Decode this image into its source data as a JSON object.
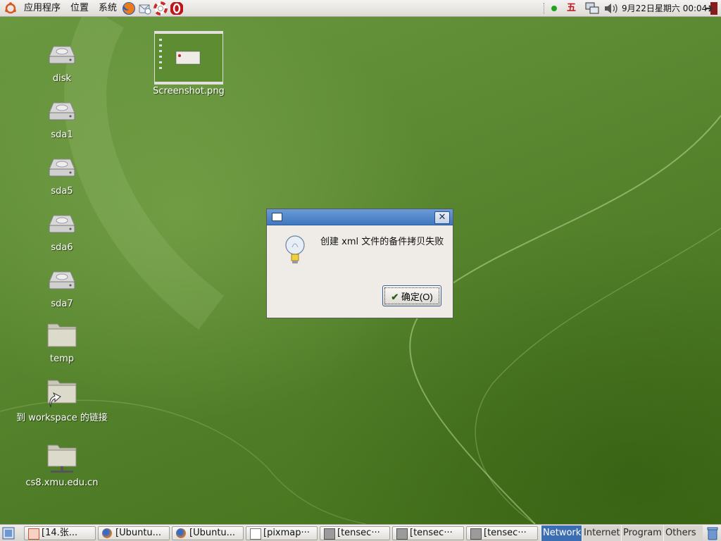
{
  "top_panel": {
    "menus": [
      "应用程序",
      "位置",
      "系统"
    ],
    "indicator_char": "五",
    "clock": "9月22日星期六 00:04"
  },
  "desktop": {
    "icons": [
      {
        "label": "disk",
        "icon": "drive-icon"
      },
      {
        "label": "sda1",
        "icon": "drive-icon"
      },
      {
        "label": "sda5",
        "icon": "drive-icon"
      },
      {
        "label": "sda6",
        "icon": "drive-icon"
      },
      {
        "label": "sda7",
        "icon": "drive-icon"
      },
      {
        "label": "temp",
        "icon": "folder-icon"
      },
      {
        "label": "到 workspace 的链接",
        "icon": "folder-link-icon"
      },
      {
        "label": "cs8.xmu.edu.cn",
        "icon": "network-folder-icon"
      }
    ],
    "screenshot_file": "Screenshot.png"
  },
  "dialog": {
    "message": "创建 xml 文件的备件拷贝失败",
    "ok_label": "确定(O)",
    "icon": "lightbulb-icon"
  },
  "bottom_panel": {
    "tasks": [
      {
        "label": "[14.张...",
        "icon": "document-icon"
      },
      {
        "label": "[Ubuntu...",
        "icon": "firefox-icon"
      },
      {
        "label": "[Ubuntu...",
        "icon": "firefox-icon"
      },
      {
        "label": "[pixmap···",
        "icon": "editor-icon"
      },
      {
        "label": "[tensec···",
        "icon": "terminal-icon"
      },
      {
        "label": "[tensec···",
        "icon": "terminal-icon"
      },
      {
        "label": "[tensec···",
        "icon": "terminal-icon"
      }
    ],
    "workspaces": [
      {
        "label": "Network",
        "active": true
      },
      {
        "label": "Internet",
        "active": false
      },
      {
        "label": "Program",
        "active": false
      },
      {
        "label": "Others",
        "active": false
      }
    ]
  },
  "colors": {
    "accent": "#3c6eb4",
    "desktop": "#5a8a30",
    "panel": "#e6e3df"
  }
}
